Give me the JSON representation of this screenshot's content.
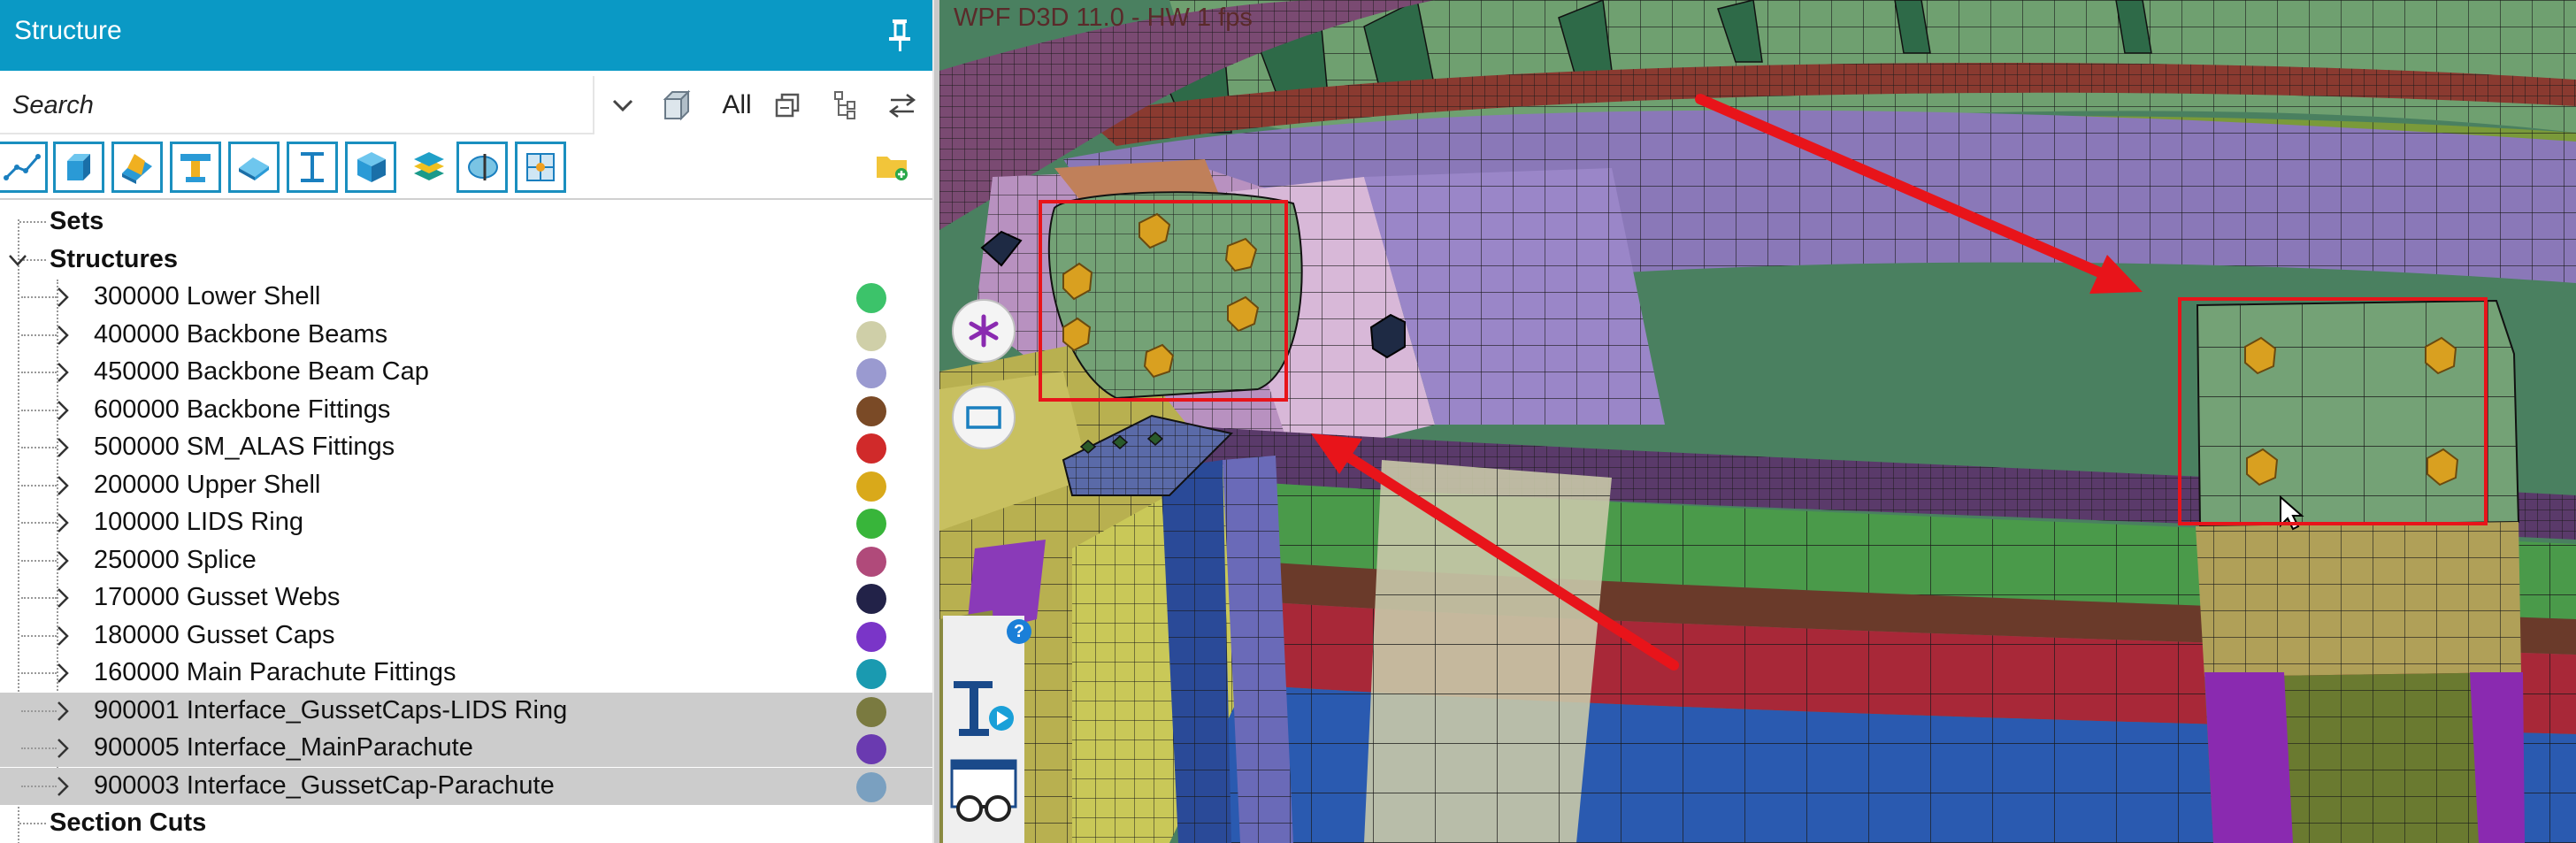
{
  "panel": {
    "title": "Structure",
    "search": {
      "placeholder": "Search",
      "value": ""
    },
    "filter_label": "All",
    "tree": {
      "sets_label": "Sets",
      "structures_label": "Structures",
      "section_cuts_label": "Section Cuts",
      "items": [
        {
          "label": "300000 Lower Shell",
          "color": "#3cc36a",
          "selected": false
        },
        {
          "label": "400000 Backbone Beams",
          "color": "#cfcfa8",
          "selected": false
        },
        {
          "label": "450000 Backbone Beam Cap",
          "color": "#9a9ad0",
          "selected": false
        },
        {
          "label": "600000 Backbone Fittings",
          "color": "#7a4a26",
          "selected": false
        },
        {
          "label": "500000 SM_ALAS Fittings",
          "color": "#d02a2a",
          "selected": false
        },
        {
          "label": "200000 Upper Shell",
          "color": "#d9a91a",
          "selected": false
        },
        {
          "label": "100000 LIDS Ring",
          "color": "#38b53a",
          "selected": false
        },
        {
          "label": "250000 Splice",
          "color": "#b04a7a",
          "selected": false
        },
        {
          "label": "170000 Gusset Webs",
          "color": "#222248",
          "selected": false
        },
        {
          "label": "180000 Gusset Caps",
          "color": "#7a35c8",
          "selected": false
        },
        {
          "label": "160000 Main Parachute Fittings",
          "color": "#1a9ab0",
          "selected": false
        },
        {
          "label": "900001 Interface_GussetCaps-LIDS Ring",
          "color": "#7a7a40",
          "selected": true
        },
        {
          "label": "900005 Interface_MainParachute",
          "color": "#6a3ab0",
          "selected": true
        },
        {
          "label": "900003 Interface_GussetCap-Parachute",
          "color": "#7aa0c0",
          "selected": true
        }
      ]
    }
  },
  "viewport": {
    "status_text": "WPF D3D 11.0 - HW  1 fps",
    "highlight_color": "#e8141a"
  },
  "icons": {
    "pin": "pin-icon",
    "dropdown": "chevron-down-icon",
    "cube": "cube-icon",
    "copy": "copy-icon",
    "hierarchy": "hierarchy-icon",
    "swap": "swap-arrows-icon",
    "new_folder": "new-folder-icon",
    "asterisk": "asterisk-icon",
    "rectangle": "rectangle-icon",
    "help": "help-icon"
  }
}
